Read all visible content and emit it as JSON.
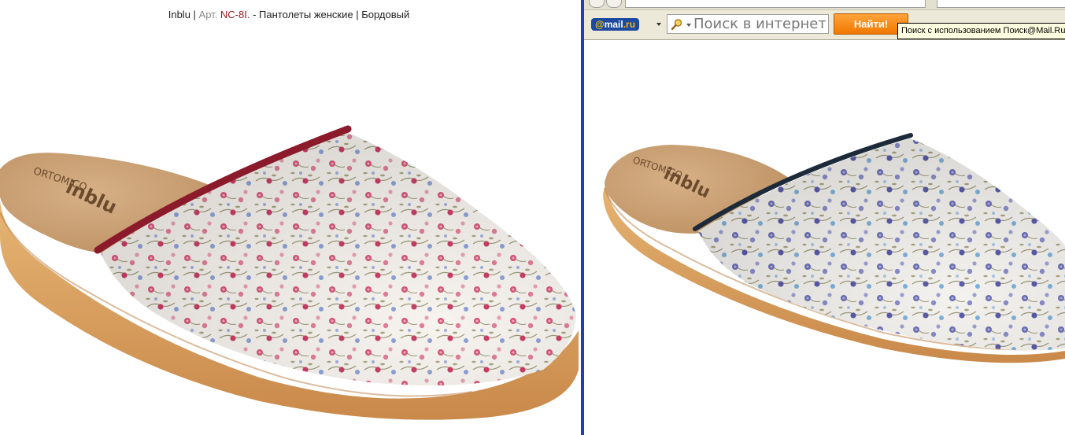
{
  "caption": {
    "brand": "Inblu",
    "sep1": " | ",
    "art_label": "Арт. ",
    "art_code": "NC-8I.",
    "sep2": " - ",
    "name": "Пантолеты женские",
    "sep3": " | ",
    "color": "Бордовый"
  },
  "toolbar": {
    "logo_at": "@",
    "logo_mail": "mail",
    "logo_ru": ".ru",
    "search_placeholder": "Поиск в интернете",
    "find_label": "Найти!",
    "tooltip": "Поиск с использованием Поиск@Mail.Ru"
  },
  "images": {
    "left_icon": "floral-slipper-burgundy-trim",
    "right_icon": "floral-slipper-navy-trim"
  },
  "colors": {
    "divider": "#1b3fb8",
    "find_button": "#f07800",
    "left_trim": "#8b1a2b",
    "right_trim": "#1c2a3a",
    "sole": "#d9a15f",
    "cork": "#c9a074"
  }
}
